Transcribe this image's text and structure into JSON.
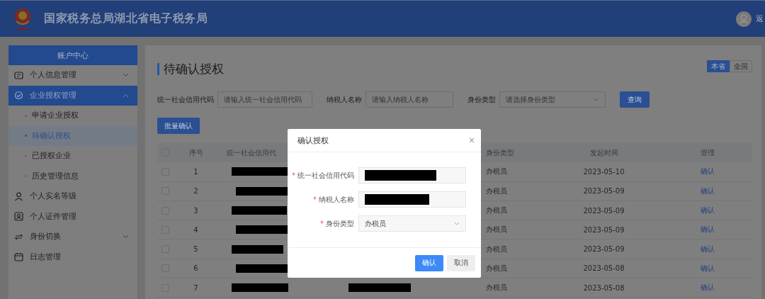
{
  "header": {
    "title": "国家税务总局湖北省电子税务局",
    "user_link": "返"
  },
  "sidebar": {
    "title": "账户中心",
    "items": [
      {
        "label": "个人信息管理",
        "selected": false,
        "expanded": false
      },
      {
        "label": "企业授权管理",
        "selected": true,
        "expanded": true,
        "children": [
          {
            "label": "申请企业授权",
            "selected": false
          },
          {
            "label": "待确认授权",
            "selected": true
          },
          {
            "label": "已授权企业",
            "selected": false
          },
          {
            "label": "历史管理信息",
            "selected": false
          }
        ]
      },
      {
        "label": "个人实名等级",
        "selected": false
      },
      {
        "label": "个人证件管理",
        "selected": false
      },
      {
        "label": "身份切换",
        "selected": false,
        "expanded": false
      },
      {
        "label": "日志管理",
        "selected": false
      }
    ]
  },
  "page": {
    "title": "待确认授权",
    "scope_toggle": [
      {
        "label": "本省",
        "selected": true
      },
      {
        "label": "全国",
        "selected": false
      }
    ],
    "filters": [
      {
        "label": "统一社会信用代码",
        "placeholder": "请输入统一社会信用代码",
        "kind": "input"
      },
      {
        "label": "纳税人名称",
        "placeholder": "请输入纳税人名称",
        "kind": "input"
      },
      {
        "label": "身份类型",
        "placeholder": "请选择身份类型",
        "kind": "select"
      }
    ],
    "query_button": "查询",
    "batch_button": "批量确认"
  },
  "table": {
    "header_checked": false,
    "columns": [
      "序号",
      "统一社会信用代",
      "身份类型",
      "发起时间",
      "管理"
    ],
    "rows": [
      {
        "checked": false,
        "index": "1",
        "identity": "办税员",
        "date": "2023-05-10",
        "action": "确认"
      },
      {
        "checked": false,
        "index": "2",
        "identity": "办税员",
        "date": "2023-05-09",
        "action": "确认"
      },
      {
        "checked": false,
        "index": "3",
        "identity": "办税员",
        "date": "2023-05-09",
        "action": "确认"
      },
      {
        "checked": false,
        "index": "4",
        "identity": "办税员",
        "date": "2023-05-09",
        "action": "确认"
      },
      {
        "checked": false,
        "index": "5",
        "identity": "办税员",
        "date": "2023-05-09",
        "action": "确认"
      },
      {
        "checked": false,
        "index": "6",
        "identity": "办税员",
        "date": "2023-05-08",
        "action": "确认"
      },
      {
        "checked": false,
        "index": "7",
        "identity": "办税员",
        "date": "2023-05-08",
        "action": "确认"
      }
    ]
  },
  "dialog": {
    "title": "确认授权",
    "close": "×",
    "fields": [
      {
        "marker": "*",
        "label": "统一社会信用代码",
        "kind": "redacted"
      },
      {
        "marker": "*",
        "label": "纳税人名称",
        "kind": "redacted"
      },
      {
        "marker": "*",
        "label": "身份类型",
        "kind": "select",
        "value": "办税员"
      }
    ],
    "buttons": [
      {
        "label": "确认",
        "kind": "primary"
      },
      {
        "label": "取消",
        "kind": "secondary"
      }
    ]
  }
}
